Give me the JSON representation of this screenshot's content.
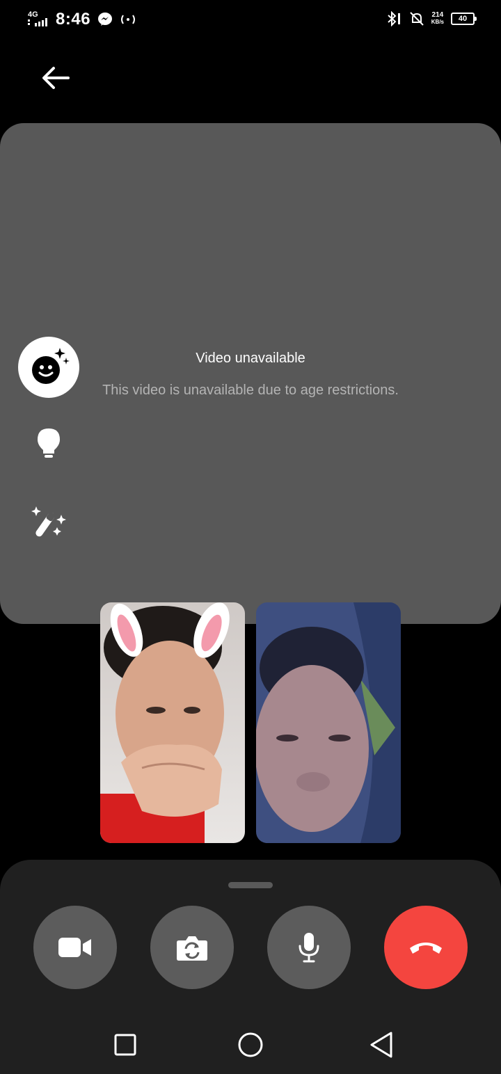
{
  "status_bar": {
    "network": "4G",
    "time": "8:46",
    "speed_value": "214",
    "speed_unit": "KB/s",
    "battery": "40"
  },
  "main_video": {
    "title": "Video unavailable",
    "message": "This video is unavailable due to age restrictions."
  },
  "side_tools": [
    "effects-icon",
    "lightbulb-icon",
    "magic-wand-icon"
  ],
  "controls": [
    {
      "name": "camera-toggle",
      "icon": "video-camera-icon"
    },
    {
      "name": "flip-camera",
      "icon": "camera-switch-icon"
    },
    {
      "name": "microphone",
      "icon": "microphone-icon"
    },
    {
      "name": "end-call",
      "icon": "phone-hangup-icon",
      "color": "#f4453f"
    }
  ],
  "nav_bar": [
    "recents-square-icon",
    "home-circle-icon",
    "back-triangle-icon"
  ]
}
